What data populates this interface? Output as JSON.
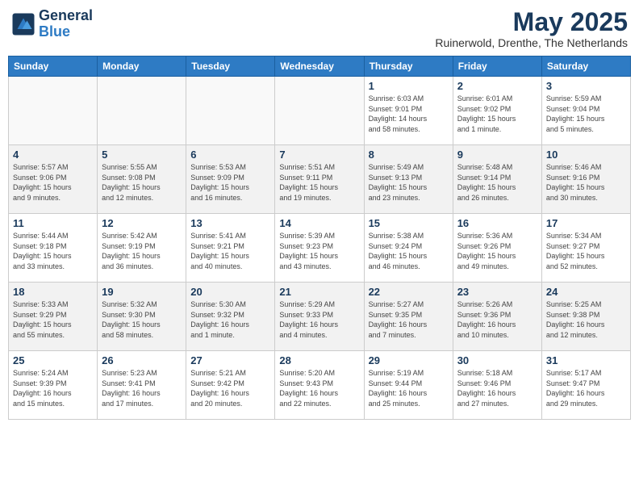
{
  "header": {
    "logo_line1": "General",
    "logo_line2": "Blue",
    "month": "May 2025",
    "location": "Ruinerwold, Drenthe, The Netherlands"
  },
  "weekdays": [
    "Sunday",
    "Monday",
    "Tuesday",
    "Wednesday",
    "Thursday",
    "Friday",
    "Saturday"
  ],
  "weeks": [
    [
      {
        "day": "",
        "info": ""
      },
      {
        "day": "",
        "info": ""
      },
      {
        "day": "",
        "info": ""
      },
      {
        "day": "",
        "info": ""
      },
      {
        "day": "1",
        "info": "Sunrise: 6:03 AM\nSunset: 9:01 PM\nDaylight: 14 hours\nand 58 minutes."
      },
      {
        "day": "2",
        "info": "Sunrise: 6:01 AM\nSunset: 9:02 PM\nDaylight: 15 hours\nand 1 minute."
      },
      {
        "day": "3",
        "info": "Sunrise: 5:59 AM\nSunset: 9:04 PM\nDaylight: 15 hours\nand 5 minutes."
      }
    ],
    [
      {
        "day": "4",
        "info": "Sunrise: 5:57 AM\nSunset: 9:06 PM\nDaylight: 15 hours\nand 9 minutes."
      },
      {
        "day": "5",
        "info": "Sunrise: 5:55 AM\nSunset: 9:08 PM\nDaylight: 15 hours\nand 12 minutes."
      },
      {
        "day": "6",
        "info": "Sunrise: 5:53 AM\nSunset: 9:09 PM\nDaylight: 15 hours\nand 16 minutes."
      },
      {
        "day": "7",
        "info": "Sunrise: 5:51 AM\nSunset: 9:11 PM\nDaylight: 15 hours\nand 19 minutes."
      },
      {
        "day": "8",
        "info": "Sunrise: 5:49 AM\nSunset: 9:13 PM\nDaylight: 15 hours\nand 23 minutes."
      },
      {
        "day": "9",
        "info": "Sunrise: 5:48 AM\nSunset: 9:14 PM\nDaylight: 15 hours\nand 26 minutes."
      },
      {
        "day": "10",
        "info": "Sunrise: 5:46 AM\nSunset: 9:16 PM\nDaylight: 15 hours\nand 30 minutes."
      }
    ],
    [
      {
        "day": "11",
        "info": "Sunrise: 5:44 AM\nSunset: 9:18 PM\nDaylight: 15 hours\nand 33 minutes."
      },
      {
        "day": "12",
        "info": "Sunrise: 5:42 AM\nSunset: 9:19 PM\nDaylight: 15 hours\nand 36 minutes."
      },
      {
        "day": "13",
        "info": "Sunrise: 5:41 AM\nSunset: 9:21 PM\nDaylight: 15 hours\nand 40 minutes."
      },
      {
        "day": "14",
        "info": "Sunrise: 5:39 AM\nSunset: 9:23 PM\nDaylight: 15 hours\nand 43 minutes."
      },
      {
        "day": "15",
        "info": "Sunrise: 5:38 AM\nSunset: 9:24 PM\nDaylight: 15 hours\nand 46 minutes."
      },
      {
        "day": "16",
        "info": "Sunrise: 5:36 AM\nSunset: 9:26 PM\nDaylight: 15 hours\nand 49 minutes."
      },
      {
        "day": "17",
        "info": "Sunrise: 5:34 AM\nSunset: 9:27 PM\nDaylight: 15 hours\nand 52 minutes."
      }
    ],
    [
      {
        "day": "18",
        "info": "Sunrise: 5:33 AM\nSunset: 9:29 PM\nDaylight: 15 hours\nand 55 minutes."
      },
      {
        "day": "19",
        "info": "Sunrise: 5:32 AM\nSunset: 9:30 PM\nDaylight: 15 hours\nand 58 minutes."
      },
      {
        "day": "20",
        "info": "Sunrise: 5:30 AM\nSunset: 9:32 PM\nDaylight: 16 hours\nand 1 minute."
      },
      {
        "day": "21",
        "info": "Sunrise: 5:29 AM\nSunset: 9:33 PM\nDaylight: 16 hours\nand 4 minutes."
      },
      {
        "day": "22",
        "info": "Sunrise: 5:27 AM\nSunset: 9:35 PM\nDaylight: 16 hours\nand 7 minutes."
      },
      {
        "day": "23",
        "info": "Sunrise: 5:26 AM\nSunset: 9:36 PM\nDaylight: 16 hours\nand 10 minutes."
      },
      {
        "day": "24",
        "info": "Sunrise: 5:25 AM\nSunset: 9:38 PM\nDaylight: 16 hours\nand 12 minutes."
      }
    ],
    [
      {
        "day": "25",
        "info": "Sunrise: 5:24 AM\nSunset: 9:39 PM\nDaylight: 16 hours\nand 15 minutes."
      },
      {
        "day": "26",
        "info": "Sunrise: 5:23 AM\nSunset: 9:41 PM\nDaylight: 16 hours\nand 17 minutes."
      },
      {
        "day": "27",
        "info": "Sunrise: 5:21 AM\nSunset: 9:42 PM\nDaylight: 16 hours\nand 20 minutes."
      },
      {
        "day": "28",
        "info": "Sunrise: 5:20 AM\nSunset: 9:43 PM\nDaylight: 16 hours\nand 22 minutes."
      },
      {
        "day": "29",
        "info": "Sunrise: 5:19 AM\nSunset: 9:44 PM\nDaylight: 16 hours\nand 25 minutes."
      },
      {
        "day": "30",
        "info": "Sunrise: 5:18 AM\nSunset: 9:46 PM\nDaylight: 16 hours\nand 27 minutes."
      },
      {
        "day": "31",
        "info": "Sunrise: 5:17 AM\nSunset: 9:47 PM\nDaylight: 16 hours\nand 29 minutes."
      }
    ]
  ]
}
